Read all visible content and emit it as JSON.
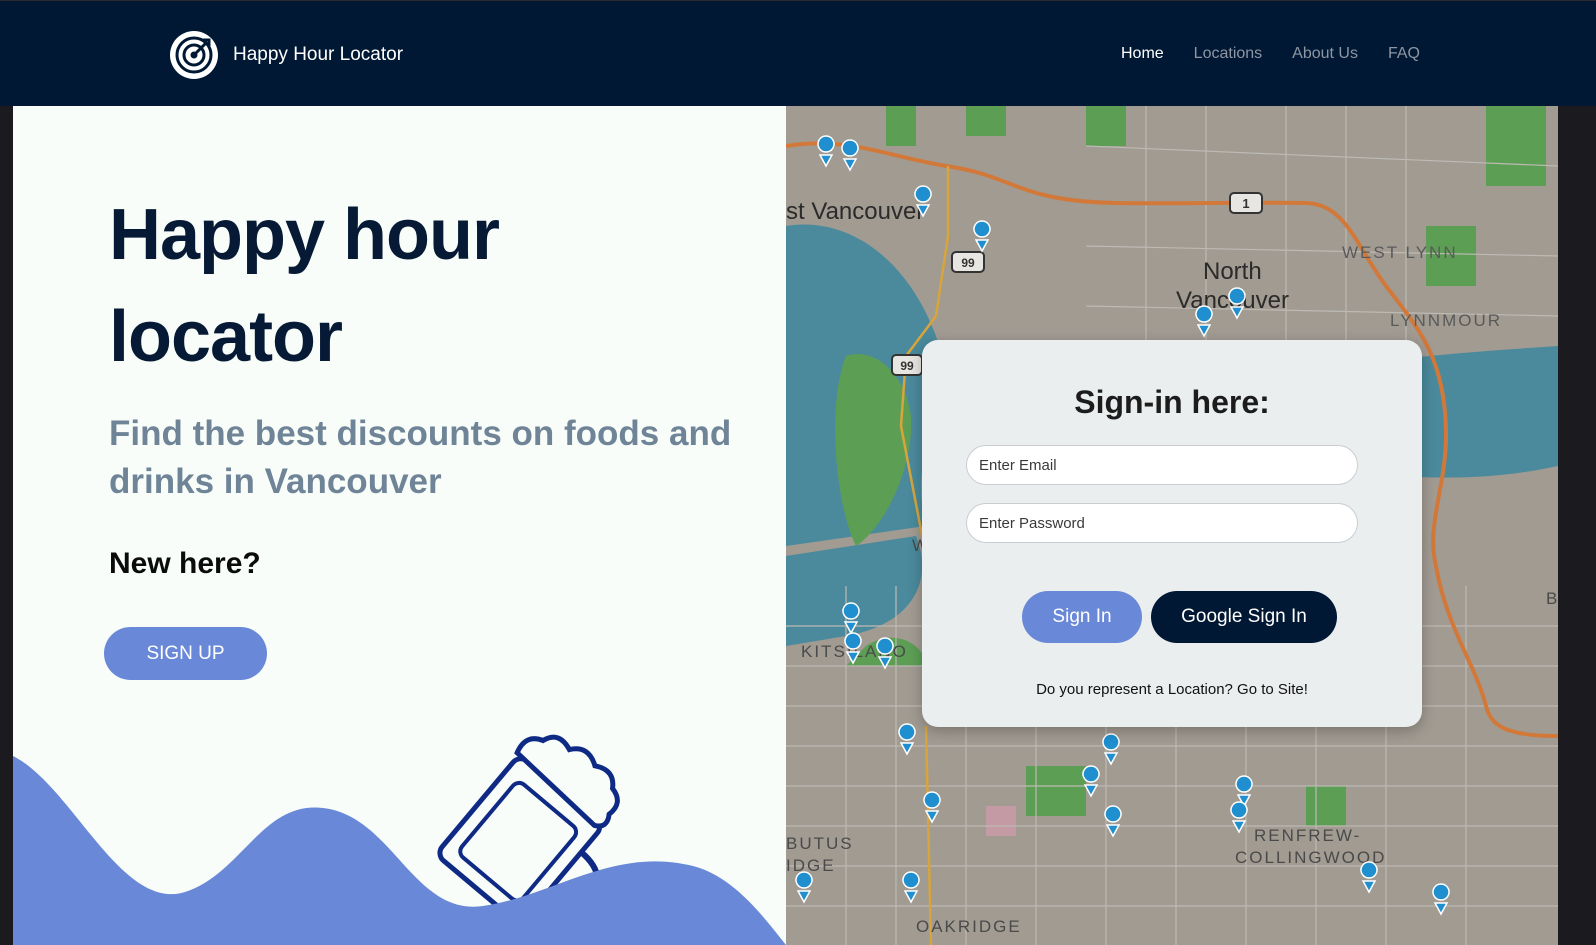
{
  "header": {
    "brand_title": "Happy Hour Locator",
    "nav": [
      {
        "label": "Home",
        "active": true
      },
      {
        "label": "Locations",
        "active": false
      },
      {
        "label": "About Us",
        "active": false
      },
      {
        "label": "FAQ",
        "active": false
      }
    ]
  },
  "hero": {
    "title_line1": "Happy hour",
    "title_line2": "locator",
    "subtitle": "Find the best discounts on foods and drinks in Vancouver",
    "new_here": "New here?",
    "signup_label": "SIGN UP"
  },
  "map": {
    "labels": [
      "st Vancouver",
      "North",
      "Vancouver",
      "WEST LYNN",
      "LYNNMOUR",
      "KITSILANO",
      "RENFREW-",
      "COLLINGWOOD",
      "BUTUS",
      "IDGE",
      "OAKRIDGE",
      "W",
      "B"
    ],
    "highway_shields": [
      "1",
      "99",
      "99"
    ]
  },
  "signin": {
    "title": "Sign-in here:",
    "email_placeholder": "Enter Email",
    "password_placeholder": "Enter Password",
    "signin_label": "Sign In",
    "google_label": "Google Sign In",
    "location_link": "Do you represent a Location? Go to Site!"
  },
  "colors": {
    "navbar": "#001833",
    "accent": "#6a88d8",
    "hero_title": "#061a36",
    "subtitle": "#6f8497",
    "map_pin": "#1f8fd0"
  }
}
